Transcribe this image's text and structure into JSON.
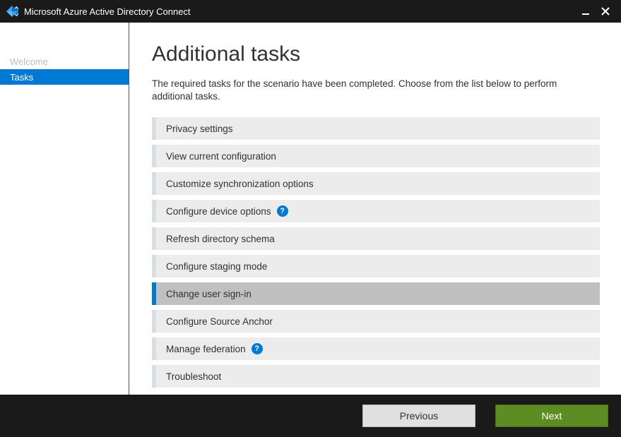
{
  "window": {
    "title": "Microsoft Azure Active Directory Connect"
  },
  "sidebar": {
    "items": [
      {
        "label": "Welcome",
        "active": false
      },
      {
        "label": "Tasks",
        "active": true
      }
    ]
  },
  "main": {
    "heading": "Additional tasks",
    "description": "The required tasks for the scenario have been completed. Choose from the list below to perform additional tasks.",
    "tasks": [
      {
        "label": "Privacy settings",
        "help": false,
        "selected": false
      },
      {
        "label": "View current configuration",
        "help": false,
        "selected": false
      },
      {
        "label": "Customize synchronization options",
        "help": false,
        "selected": false
      },
      {
        "label": "Configure device options",
        "help": true,
        "selected": false
      },
      {
        "label": "Refresh directory schema",
        "help": false,
        "selected": false
      },
      {
        "label": "Configure staging mode",
        "help": false,
        "selected": false
      },
      {
        "label": "Change user sign-in",
        "help": false,
        "selected": true
      },
      {
        "label": "Configure Source Anchor",
        "help": false,
        "selected": false
      },
      {
        "label": "Manage federation",
        "help": true,
        "selected": false
      },
      {
        "label": "Troubleshoot",
        "help": false,
        "selected": false
      }
    ]
  },
  "footer": {
    "previous": "Previous",
    "next": "Next"
  },
  "helpGlyph": "?"
}
